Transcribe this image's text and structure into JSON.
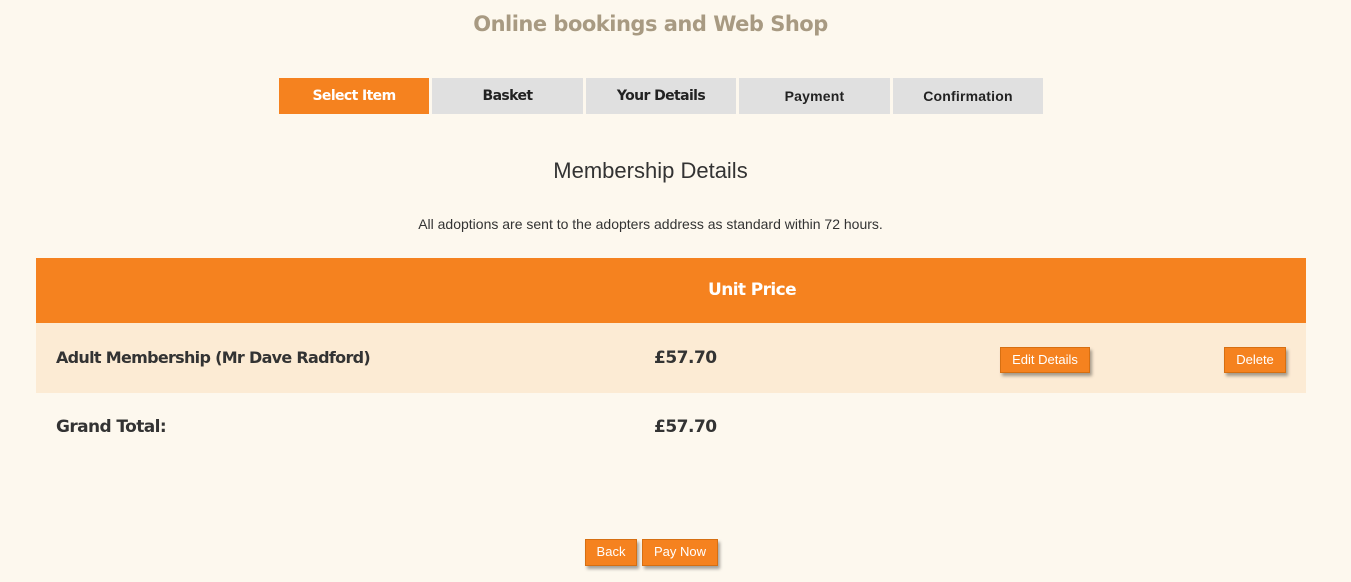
{
  "header": {
    "title": "Online bookings and Web Shop"
  },
  "steps": [
    {
      "label": "Select Item",
      "active": true
    },
    {
      "label": "Basket",
      "active": false
    },
    {
      "label": "Your Details",
      "active": false
    },
    {
      "label": "Payment",
      "active": false
    },
    {
      "label": "Confirmation",
      "active": false
    }
  ],
  "main": {
    "heading": "Membership Details",
    "note": "All adoptions are sent to the adopters address as standard within 72 hours."
  },
  "table": {
    "columns": {
      "unit_price": "Unit Price"
    },
    "rows": [
      {
        "item": "Adult Membership (Mr Dave Radford)",
        "unit_price": "£57.70",
        "edit_label": "Edit Details",
        "delete_label": "Delete"
      }
    ],
    "grand_total_label": "Grand Total:",
    "grand_total_value": "£57.70"
  },
  "footer": {
    "back_label": "Back",
    "pay_label": "Pay Now"
  },
  "colors": {
    "accent": "#f5821f",
    "background": "#fdf8ee",
    "row_background": "#fcebd4",
    "inactive_step": "#e0e0e0",
    "title_color": "#a89a82"
  }
}
